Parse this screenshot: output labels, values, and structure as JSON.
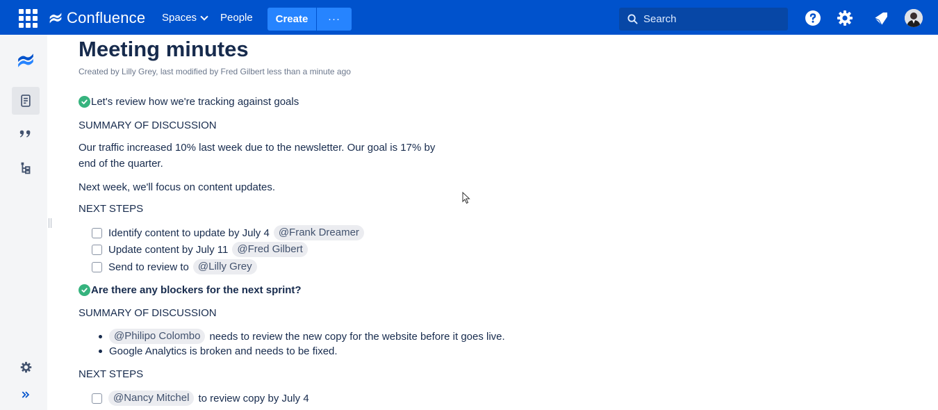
{
  "topnav": {
    "logo_text": "Confluence",
    "spaces_label": "Spaces",
    "people_label": "People",
    "create_label": "Create",
    "more_label": "···",
    "search_placeholder": "Search",
    "icons": [
      "app-switcher-icon",
      "confluence-logo-icon",
      "help-icon",
      "settings-icon",
      "notifications-icon",
      "avatar"
    ]
  },
  "sidebar": {
    "icons": [
      "confluence-logo-icon",
      "pages-icon",
      "blog-quote-icon",
      "page-tree-icon",
      "space-settings-icon",
      "expand-sidebar-icon"
    ]
  },
  "page": {
    "title": "Meeting minutes",
    "byline": "Created by Lilly Grey, last modified by Fred Gilbert less than a minute ago",
    "sections": [
      {
        "heading": "Let's review how we're tracking against goals",
        "summary_label": "SUMMARY OF DISCUSSION",
        "paragraphs": [
          "Our traffic increased 10% last week due to the newsletter. Our goal is 17% by end of the quarter.",
          "Next week, we'll focus on content updates."
        ],
        "next_steps_label": "NEXT STEPS",
        "tasks": [
          {
            "text": "Identify content to update by July 4",
            "mention": "@Frank Dreamer"
          },
          {
            "text": "Update content by July 11",
            "mention": "@Fred Gilbert"
          },
          {
            "text": "Send to review to",
            "mention": "@Lilly Grey"
          }
        ]
      },
      {
        "heading": "Are there any blockers for the next sprint?",
        "summary_label": "SUMMARY OF DISCUSSION",
        "bullets": [
          {
            "mention": "@Philipo Colombo",
            "text": "needs to review the new copy for the website before it goes live."
          },
          {
            "text": "Google Analytics is broken and needs to be fixed."
          }
        ],
        "next_steps_label": "NEXT STEPS",
        "tasks": [
          {
            "mention": "@Nancy Mitchel",
            "text": "to review copy by July 4"
          }
        ]
      }
    ]
  },
  "colors": {
    "nav_bg": "#0052cc",
    "create_bg": "#2684ff",
    "search_bg": "#0747a6",
    "decision_green": "#36b37e",
    "text": "#172b4d",
    "sidebar_bg": "#f4f5f7"
  }
}
